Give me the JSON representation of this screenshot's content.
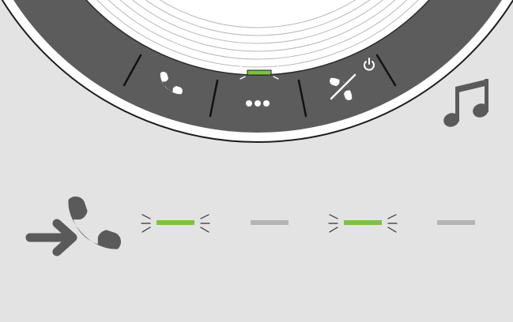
{
  "device": {
    "name": "speakerphone",
    "buttons": [
      {
        "name": "call-button",
        "icon": "phone-icon"
      },
      {
        "name": "more-button",
        "icon": "three-dots-icon",
        "status_led": "blinking"
      },
      {
        "name": "hangup-power-button",
        "icon": "phone-hangup-icon",
        "secondary_icon": "power-icon"
      }
    ]
  },
  "indicators": {
    "audio": "music-note-icon",
    "event": "incoming-call-icon"
  },
  "led_sequence": [
    {
      "state": "on",
      "blinking": true
    },
    {
      "state": "off",
      "blinking": false
    },
    {
      "state": "on",
      "blinking": true
    },
    {
      "state": "off",
      "blinking": false
    }
  ],
  "colors": {
    "background": "#e3e3e3",
    "device_ring": "#5c5c5c",
    "device_face": "#ffffff",
    "icon": "#5a5a5a",
    "led_on": "#7cc242",
    "led_off": "#b4b4b4",
    "outline": "#1c1c1c"
  }
}
